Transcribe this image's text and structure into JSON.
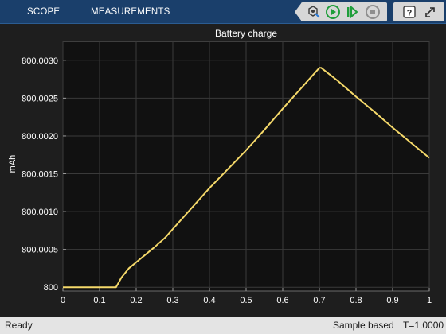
{
  "toolstrip": {
    "tabs": [
      {
        "label": "SCOPE"
      },
      {
        "label": "MEASUREMENTS"
      }
    ],
    "buttons": [
      {
        "icon": "highlight-signal-icon"
      },
      {
        "icon": "run-icon"
      },
      {
        "icon": "step-forward-icon"
      },
      {
        "icon": "stop-icon"
      },
      {
        "icon": "help-icon"
      },
      {
        "icon": "undock-icon"
      }
    ]
  },
  "plot": {
    "title": "Battery charge",
    "ylabel": "mAh"
  },
  "chart_data": {
    "type": "line",
    "title": "Battery charge",
    "xlabel": "",
    "ylabel": "mAh",
    "xlim": [
      0,
      1
    ],
    "ylim": [
      799.99995,
      800.00325
    ],
    "xticks": [
      "0",
      "0.1",
      "0.2",
      "0.3",
      "0.4",
      "0.5",
      "0.6",
      "0.7",
      "0.8",
      "0.9",
      "1"
    ],
    "yticks": [
      "800",
      "800.0005",
      "800.0010",
      "800.0015",
      "800.0020",
      "800.0025",
      "800.0030"
    ],
    "grid": true,
    "series": [
      {
        "color": "#f5d96a",
        "x": [
          0,
          0.14,
          0.145,
          0.16,
          0.18,
          0.2,
          0.25,
          0.28,
          0.3,
          0.35,
          0.4,
          0.45,
          0.5,
          0.55,
          0.6,
          0.65,
          0.7,
          0.705,
          0.75,
          0.8,
          0.85,
          0.9,
          0.95,
          1
        ],
        "y": [
          800,
          800,
          800.0,
          800.00013,
          800.00025,
          800.00033,
          800.00053,
          800.00066,
          800.00077,
          800.00104,
          800.00131,
          800.00156,
          800.00181,
          800.00208,
          800.00236,
          800.00263,
          800.0029,
          800.0029,
          800.00273,
          800.00252,
          800.00232,
          800.00211,
          800.00191,
          800.00171
        ]
      }
    ]
  },
  "colors": {
    "toolstrip": "#1a3f6b",
    "plot_bg": "#111111",
    "figure_bg": "#1e1e1e",
    "grid": "#3a3a3a",
    "line": "#f5d96a",
    "run_green": "#1f9e3a",
    "status_bg": "#e4e4e4"
  },
  "status": {
    "state": "Ready",
    "mode": "Sample based",
    "time": "T=1.0000"
  }
}
